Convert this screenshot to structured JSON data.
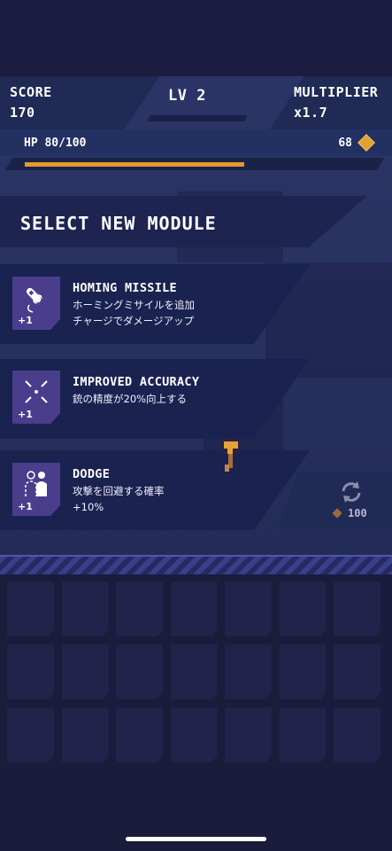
{
  "hud": {
    "score_label": "SCORE",
    "score_value": "170",
    "level_label": "LV 2",
    "multiplier_label": "MULTIPLIER",
    "multiplier_value": "x1.7"
  },
  "health": {
    "label": "HP 80/100",
    "current": 80,
    "max": 100,
    "coins": "68"
  },
  "select_banner": "SELECT NEW MODULE",
  "modules": [
    {
      "icon": "missile-icon",
      "level": "+1",
      "title": "HOMING MISSILE",
      "desc_line1": "ホーミングミサイルを追加",
      "desc_line2": "チャージでダメージアップ"
    },
    {
      "icon": "crosshair-icon",
      "level": "+1",
      "title": "IMPROVED ACCURACY",
      "desc_line1": "銃の精度が20%向上する",
      "desc_line2": ""
    },
    {
      "icon": "dodge-icon",
      "level": "+1",
      "title": "DODGE",
      "desc_line1": "攻撃を回避する確率",
      "desc_line2": "+10%"
    }
  ],
  "reroll": {
    "icon": "refresh-icon",
    "cost": "100"
  },
  "inventory": {
    "rows": 3,
    "cols": 7
  },
  "colors": {
    "accent": "#e59a2a",
    "module_icon_bg": "#4a3d8c",
    "background": "#1b1b3c"
  }
}
